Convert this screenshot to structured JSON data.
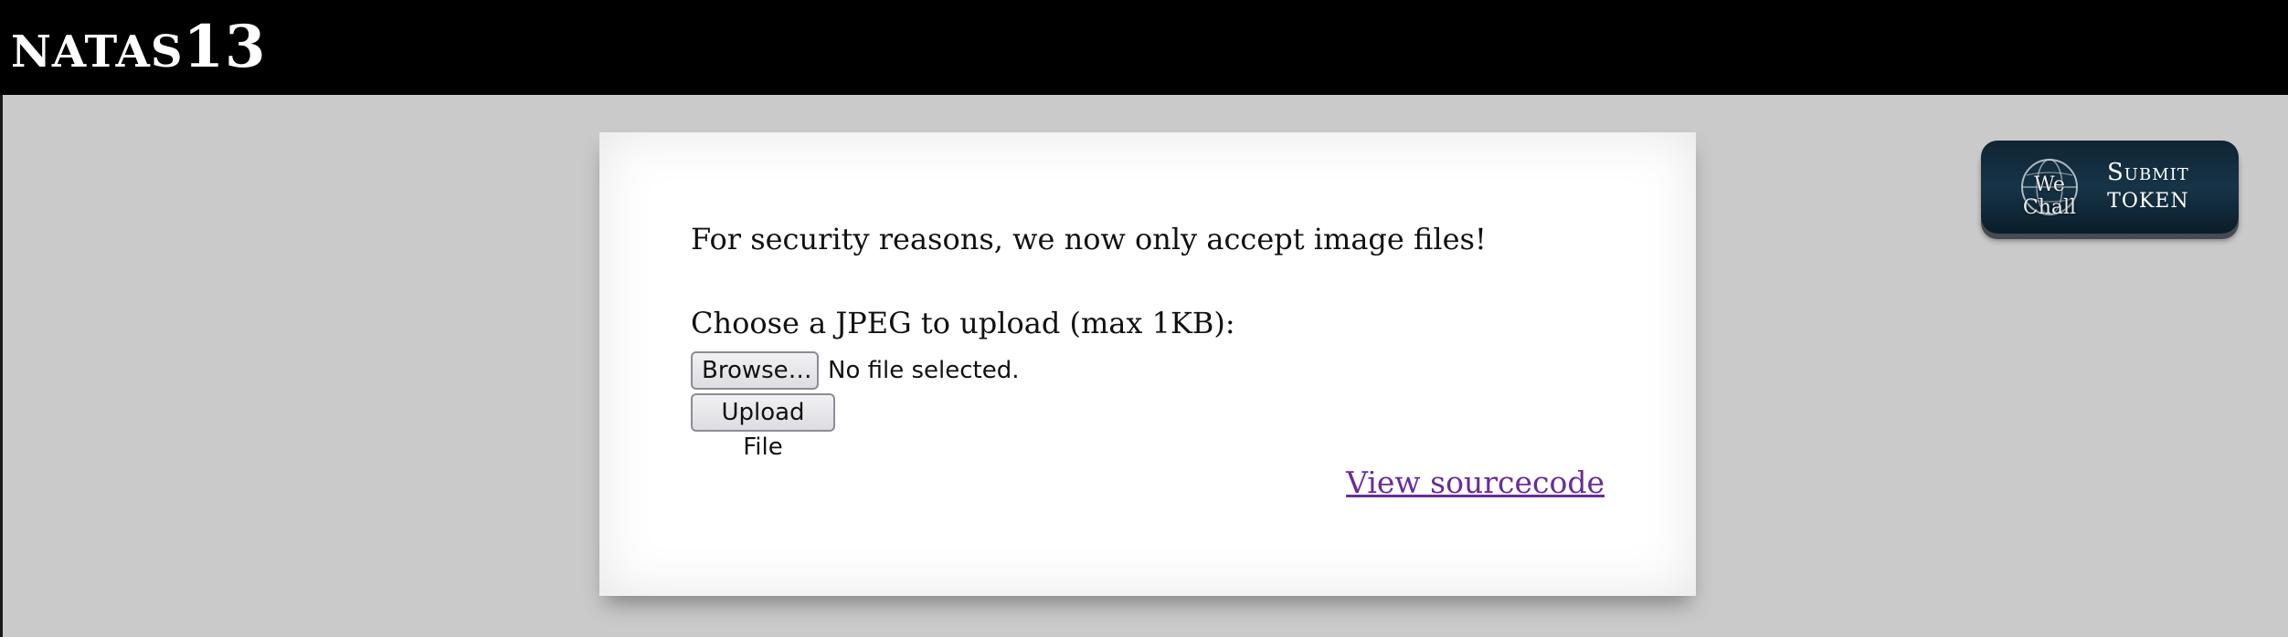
{
  "header": {
    "title_prefix": "NATAS",
    "title_number": "13"
  },
  "main": {
    "notice": "For security reasons, we now only accept image files!",
    "upload_label": "Choose a JPEG to upload (max 1KB):",
    "browse_label": "Browse…",
    "file_status": "No file selected.",
    "upload_button_label": "Upload File",
    "source_link": "View sourcecode"
  },
  "submit_token": {
    "brand": "We Chall",
    "line1": "Submit",
    "line2": "Token",
    "icon": "globe-icon"
  },
  "colors": {
    "header_bg": "#000000",
    "page_bg": "#cacaca",
    "link": "#6a2c9c",
    "token_button_bg": "#163447"
  }
}
